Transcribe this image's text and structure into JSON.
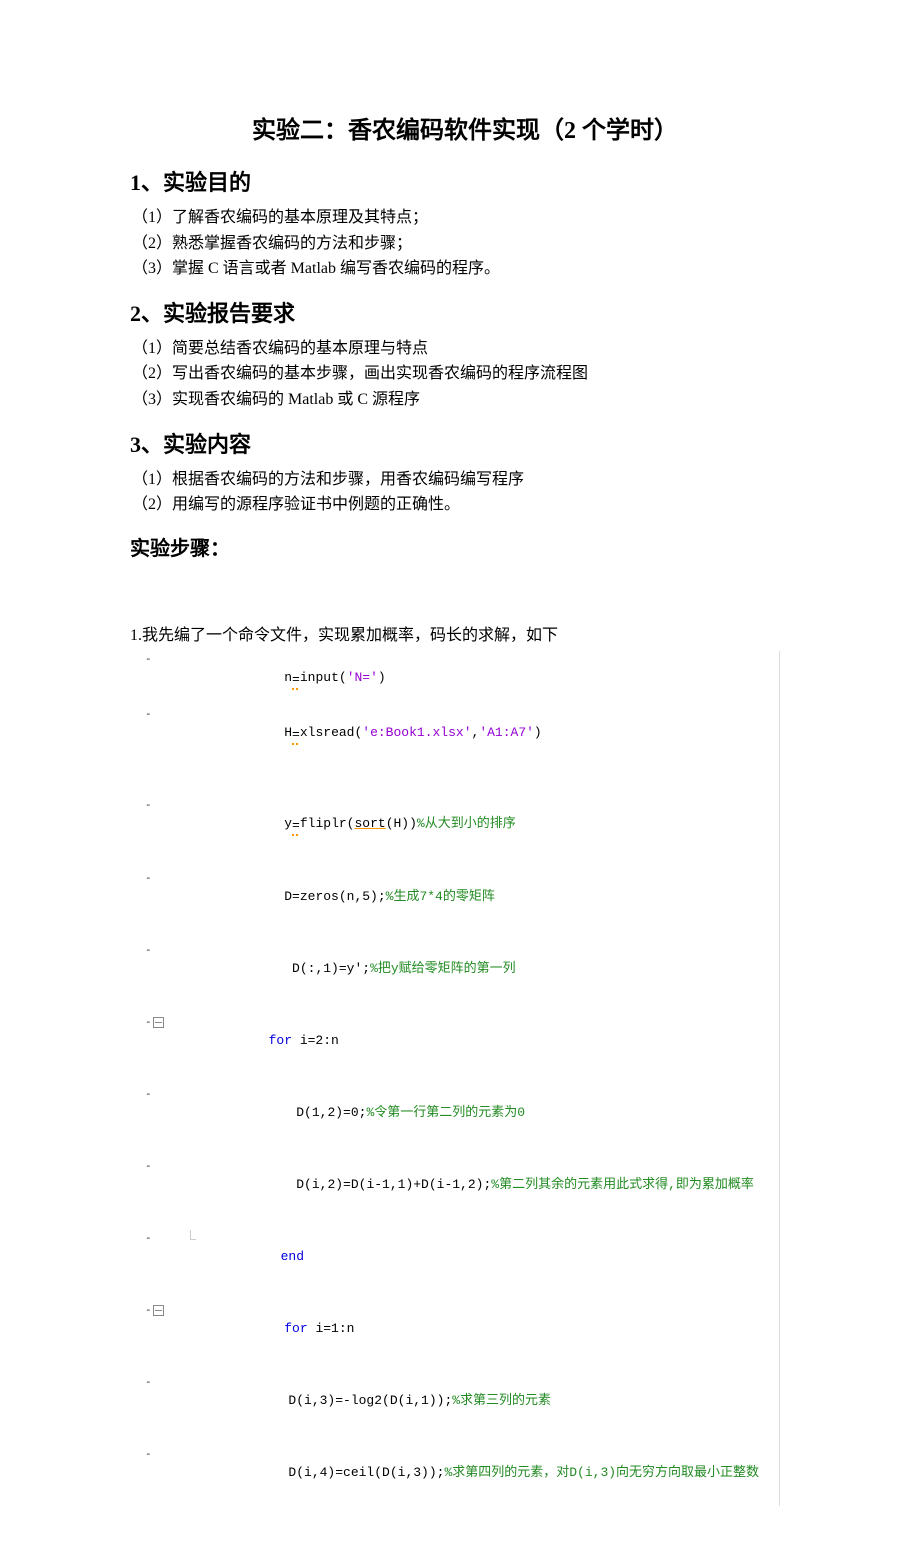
{
  "title": "实验二：香农编码软件实现（2 个学时）",
  "sections": {
    "s1": {
      "header": "1、实验目的",
      "items": [
        "（1）了解香农编码的基本原理及其特点；",
        "（2）熟悉掌握香农编码的方法和步骤；",
        "（3）掌握 C 语言或者 Matlab 编写香农编码的程序。"
      ]
    },
    "s2": {
      "header": "2、实验报告要求",
      "items": [
        "（1）简要总结香农编码的基本原理与特点",
        "（2）写出香农编码的基本步骤，画出实现香农编码的程序流程图",
        "（3）实现香农编码的 Matlab 或 C 源程序"
      ]
    },
    "s3": {
      "header": "3、实验内容",
      "items": [
        "（1）根据香农编码的方法和步骤，用香农编码编写程序",
        "（2）用编写的源程序验证书中例题的正确性。"
      ]
    }
  },
  "steps_header": "实验步骤：",
  "intro_line": "1.我先编了一个命令文件，实现累加概率，码长的求解，如下",
  "code": {
    "l1": {
      "pre": "n",
      "op": "=",
      "fn": "input",
      "paren_open": "(",
      "str": "'N='",
      "paren_close": ")"
    },
    "l2": {
      "pre": "H",
      "op": "=",
      "fn": "xlsread",
      "paren_open": "(",
      "str1": "'e:Book1.xlsx'",
      "comma": ",",
      "str2": "'A1:A7'",
      "paren_close": ")"
    },
    "l3": {
      "pre": "y",
      "op": "=",
      "fn1": "fliplr",
      "paren_open": "(",
      "fn2": "sort",
      "arg": "(H))",
      "comment": "%从大到小的排序"
    },
    "l4": {
      "txt": "D=zeros(n,5);",
      "comment": "%生成7*4的零矩阵"
    },
    "l5": {
      "txt": " D(:,1)=y';",
      "comment": "%把y赋给零矩阵的第一列"
    },
    "l6": {
      "kw": "for",
      "txt": " i=2:n"
    },
    "l7": {
      "txt": "D(1,2)=0;",
      "comment": "%令第一行第二列的元素为0"
    },
    "l8": {
      "txt": "D(i,2)=D(i-1,1)+D(i-1,2);",
      "comment": "%第二列其余的元素用此式求得,即为累加概率"
    },
    "l9": {
      "kw": "end"
    },
    "l10": {
      "kw": "for",
      "txt": " i=1:n"
    },
    "l11": {
      "txt": "D(i,3)=-log2(D(i,1));",
      "comment": "%求第三列的元素"
    },
    "l12": {
      "txt": "D(i,4)=ceil(D(i,3));",
      "comment": "%求第四列的元素，对D(i,3)向无穷方向取最小正整数"
    }
  }
}
